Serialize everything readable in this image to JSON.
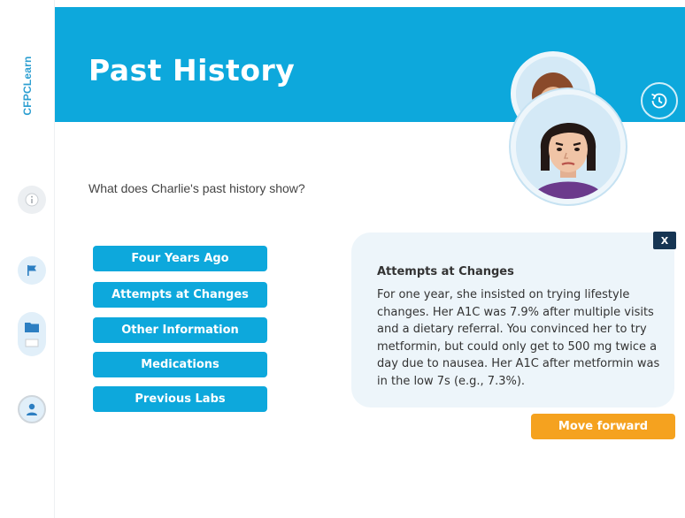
{
  "brand": {
    "name": "CFPCLearn"
  },
  "header": {
    "title": "Past History"
  },
  "question": "What does Charlie's past history show?",
  "topics": [
    {
      "label": "Four Years Ago"
    },
    {
      "label": "Attempts at Changes"
    },
    {
      "label": "Other Information"
    },
    {
      "label": "Medications"
    },
    {
      "label": "Previous Labs"
    }
  ],
  "panel": {
    "title": "Attempts at Changes",
    "body": "For one year, she insisted on trying lifestyle changes. Her A1C was 7.9% after multiple visits and a dietary referral. You convinced her to try metformin, but could only get to 500 mg twice a day due to nausea. Her A1C after metformin was in the low 7s (e.g., 7.3%).",
    "close_label": "X"
  },
  "footer": {
    "next_label": "Move forward"
  },
  "sidebar_icons": [
    "info-icon",
    "flag-icon",
    "folder-icon",
    "user-icon"
  ],
  "colors": {
    "accent": "#0da8dc",
    "orange": "#f5a21f",
    "navy": "#163553",
    "panel_bg": "#edf5fa"
  }
}
